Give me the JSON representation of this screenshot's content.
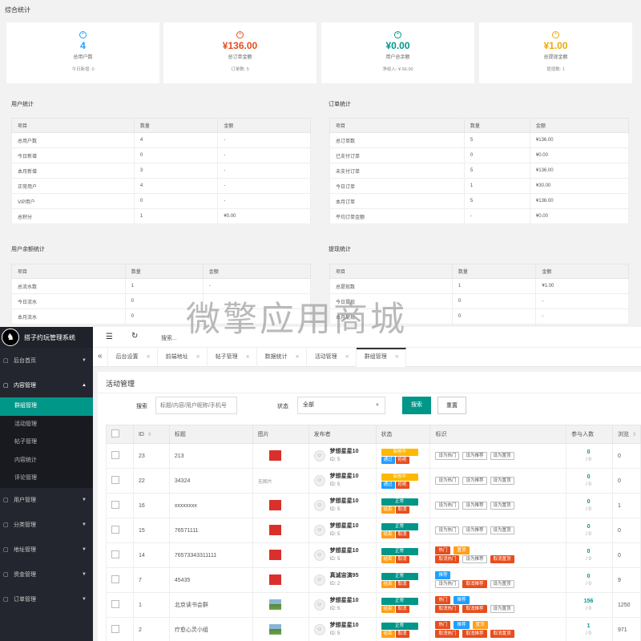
{
  "overview": {
    "title": "综合统计",
    "cards": [
      {
        "icon": "user-icon",
        "value": "4",
        "label": "总用户数",
        "sub": "今日新增: 0",
        "color": "#1e9fff"
      },
      {
        "icon": "order-icon",
        "value": "¥136.00",
        "label": "总订单金额",
        "sub": "订单数: 5",
        "color": "#e64e1e"
      },
      {
        "icon": "wallet-icon",
        "value": "¥0.00",
        "label": "用户总余额",
        "sub": "净收入: ¥-56.00",
        "color": "#009688"
      },
      {
        "icon": "withdraw-icon",
        "value": "¥1.00",
        "label": "总提现金额",
        "sub": "提现数: 1",
        "color": "#f0a800"
      }
    ]
  },
  "user_stats": {
    "title": "用户统计",
    "headers": [
      "项目",
      "数量",
      "金额"
    ],
    "rows": [
      [
        "总用户数",
        "4",
        "-"
      ],
      [
        "今日新增",
        "0",
        "-"
      ],
      [
        "本月新增",
        "3",
        "-"
      ],
      [
        "正常用户",
        "4",
        "-"
      ],
      [
        "VIP用户",
        "0",
        "-"
      ],
      [
        "总积分",
        "1",
        "¥0.00"
      ]
    ]
  },
  "order_stats": {
    "title": "订单统计",
    "headers": [
      "项目",
      "数量",
      "金额"
    ],
    "rows": [
      [
        "总订单数",
        "5",
        "¥136.00"
      ],
      [
        "已支付订单",
        "0",
        "¥0.00"
      ],
      [
        "未支付订单",
        "5",
        "¥136.00"
      ],
      [
        "今日订单",
        "1",
        "¥30.00"
      ],
      [
        "本月订单",
        "5",
        "¥136.00"
      ],
      [
        "平均订单金额",
        "-",
        "¥0.00"
      ]
    ]
  },
  "balance_stats": {
    "title": "用户余额统计",
    "headers": [
      "项目",
      "数量",
      "金额"
    ],
    "rows": [
      [
        "总流水数",
        "1",
        "-"
      ],
      [
        "今日流水",
        "0",
        ""
      ],
      [
        "本月流水",
        "0",
        ""
      ]
    ]
  },
  "withdraw_stats": {
    "title": "提现统计",
    "headers": [
      "项目",
      "数量",
      "金额"
    ],
    "rows": [
      [
        "总提现数",
        "1",
        "¥1.00"
      ],
      [
        "今日提现",
        "0",
        "-"
      ],
      [
        "本月提现",
        "0",
        "-"
      ]
    ]
  },
  "watermark": "微擎应用商城",
  "app": {
    "title": "搭子约玩管理系统"
  },
  "topbar": {
    "search_text": "搜索..."
  },
  "sidebar": {
    "items": [
      {
        "label": "后台首页",
        "icon": "home-icon"
      },
      {
        "label": "内容管理",
        "icon": "content-icon",
        "open": true,
        "children": [
          "群组管理",
          "活动管理",
          "帖子管理",
          "内容统计",
          "评论管理"
        ]
      },
      {
        "label": "用户管理",
        "icon": "user-manage-icon"
      },
      {
        "label": "分类管理",
        "icon": "category-icon"
      },
      {
        "label": "地址管理",
        "icon": "address-icon"
      },
      {
        "label": "资金管理",
        "icon": "money-icon"
      },
      {
        "label": "订单管理",
        "icon": "order-manage-icon"
      }
    ],
    "active_child": "群组管理"
  },
  "tabs": [
    "后台设置",
    "前端地址",
    "帖子管理",
    "数据统计",
    "活动管理",
    "群组管理"
  ],
  "active_tab": "群组管理",
  "main": {
    "title": "活动管理",
    "search_label": "搜索",
    "search_placeholder": "标题/内容/用户昵称/手机号",
    "status_label": "状态",
    "status_value": "全部",
    "search_button": "搜索",
    "reset_button": "重置",
    "columns": [
      "ID",
      "标题",
      "图片",
      "发布者",
      "状态",
      "标识",
      "参与人数",
      "浏览"
    ],
    "rows": [
      {
        "id": "23",
        "title": "213",
        "pic": "red",
        "author": "梦想星星10",
        "uid": "ID: 5",
        "status": [
          {
            "t": "审核中",
            "c": "#ffb800"
          }
        ],
        "actions": [
          {
            "t": "通过",
            "c": "#1e9fff"
          },
          {
            "t": "拒绝",
            "c": "#e64e1e"
          }
        ],
        "marks": [
          [
            {
              "t": "设为热门",
              "s": ""
            },
            {
              "t": "设为推荐",
              "s": ""
            },
            {
              "t": "设为置顶",
              "s": ""
            }
          ]
        ],
        "joined": "0",
        "joined_sub": "/ 0",
        "views": "0"
      },
      {
        "id": "22",
        "title": "34324",
        "pic": "none",
        "pic_text": "无图片",
        "author": "梦想星星10",
        "uid": "ID: 5",
        "status": [
          {
            "t": "审核中",
            "c": "#ffb800"
          }
        ],
        "actions": [
          {
            "t": "通过",
            "c": "#1e9fff"
          },
          {
            "t": "拒绝",
            "c": "#e64e1e"
          }
        ],
        "marks": [
          [
            {
              "t": "设为热门",
              "s": ""
            },
            {
              "t": "设为推荐",
              "s": ""
            },
            {
              "t": "设为置顶",
              "s": ""
            }
          ]
        ],
        "joined": "0",
        "joined_sub": "/ 0",
        "views": "0"
      },
      {
        "id": "16",
        "title": "xxxxxxxx",
        "pic": "red",
        "author": "梦想星星10",
        "uid": "ID: 5",
        "status": [
          {
            "t": "正常",
            "c": "#009688"
          }
        ],
        "actions": [
          {
            "t": "结束",
            "c": "#ff9f1a"
          },
          {
            "t": "取消",
            "c": "#e64e1e"
          }
        ],
        "marks": [
          [
            {
              "t": "设为热门",
              "s": ""
            },
            {
              "t": "设为推荐",
              "s": ""
            },
            {
              "t": "设为置顶",
              "s": ""
            }
          ]
        ],
        "joined": "0",
        "joined_sub": "/ 0",
        "views": "1"
      },
      {
        "id": "15",
        "title": "76571111",
        "pic": "red",
        "author": "梦想星星10",
        "uid": "ID: 5",
        "status": [
          {
            "t": "正常",
            "c": "#009688"
          }
        ],
        "actions": [
          {
            "t": "结束",
            "c": "#ff9f1a"
          },
          {
            "t": "取消",
            "c": "#e64e1e"
          }
        ],
        "marks": [
          [
            {
              "t": "设为热门",
              "s": ""
            },
            {
              "t": "设为推荐",
              "s": ""
            },
            {
              "t": "设为置顶",
              "s": ""
            }
          ]
        ],
        "joined": "0",
        "joined_sub": "/ 0",
        "views": "0"
      },
      {
        "id": "14",
        "title": "76573343311111",
        "pic": "red",
        "author": "梦想星星10",
        "uid": "ID: 5",
        "status": [
          {
            "t": "正常",
            "c": "#009688"
          }
        ],
        "actions": [
          {
            "t": "结束",
            "c": "#ff9f1a"
          },
          {
            "t": "取消",
            "c": "#e64e1e"
          }
        ],
        "marks": [
          [
            {
              "t": "热门",
              "s": "red"
            },
            {
              "t": "置顶",
              "s": "orange"
            }
          ],
          [
            {
              "t": "取消热门",
              "s": "red"
            },
            {
              "t": "设为推荐",
              "s": ""
            },
            {
              "t": "取消置顶",
              "s": "red"
            }
          ]
        ],
        "joined": "0",
        "joined_sub": "/ 0",
        "views": "0"
      },
      {
        "id": "7",
        "title": "45435",
        "pic": "red",
        "author": "真诚宙演95",
        "uid": "ID: 2",
        "status": [
          {
            "t": "正常",
            "c": "#009688"
          }
        ],
        "actions": [
          {
            "t": "结束",
            "c": "#ff9f1a"
          },
          {
            "t": "取消",
            "c": "#e64e1e"
          }
        ],
        "marks": [
          [
            {
              "t": "推荐",
              "s": "blue"
            }
          ],
          [
            {
              "t": "设为热门",
              "s": ""
            },
            {
              "t": "取消推荐",
              "s": "red"
            },
            {
              "t": "设为置顶",
              "s": ""
            }
          ]
        ],
        "joined": "0",
        "joined_sub": "/ 0",
        "views": "9"
      },
      {
        "id": "1",
        "title": "北京读书会群",
        "pic": "land",
        "author": "梦想星星10",
        "uid": "ID: 5",
        "status": [
          {
            "t": "正常",
            "c": "#009688"
          }
        ],
        "actions": [
          {
            "t": "结束",
            "c": "#ff9f1a"
          },
          {
            "t": "取消",
            "c": "#e64e1e"
          }
        ],
        "marks": [
          [
            {
              "t": "热门",
              "s": "red"
            },
            {
              "t": "推荐",
              "s": "blue"
            }
          ],
          [
            {
              "t": "取消热门",
              "s": "red"
            },
            {
              "t": "取消推荐",
              "s": "red"
            },
            {
              "t": "设为置顶",
              "s": ""
            }
          ]
        ],
        "joined": "156",
        "joined_sub": "/ 0",
        "views": "1250"
      },
      {
        "id": "2",
        "title": "疗愈心灵小组",
        "pic": "land",
        "author": "梦想星星10",
        "uid": "ID: 5",
        "status": [
          {
            "t": "正常",
            "c": "#009688"
          }
        ],
        "actions": [
          {
            "t": "结束",
            "c": "#ff9f1a"
          },
          {
            "t": "取消",
            "c": "#e64e1e"
          }
        ],
        "marks": [
          [
            {
              "t": "热门",
              "s": "red"
            },
            {
              "t": "推荐",
              "s": "blue"
            },
            {
              "t": "置顶",
              "s": "orange"
            }
          ],
          [
            {
              "t": "取消热门",
              "s": "red"
            },
            {
              "t": "取消推荐",
              "s": "red"
            },
            {
              "t": "取消置顶",
              "s": "red"
            }
          ]
        ],
        "joined": "1",
        "joined_sub": "/ 0",
        "views": "971"
      }
    ]
  }
}
